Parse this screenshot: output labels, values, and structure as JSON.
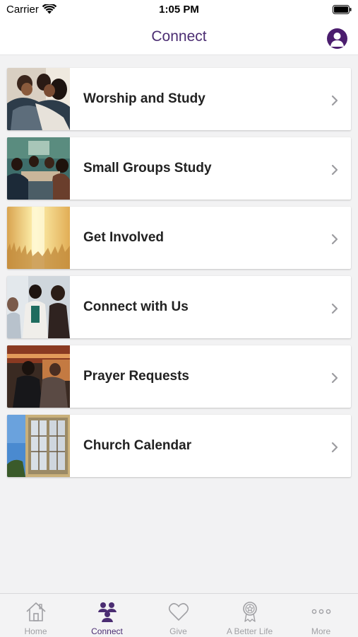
{
  "status": {
    "carrier": "Carrier",
    "time": "1:05 PM"
  },
  "header": {
    "title": "Connect"
  },
  "menu": {
    "items": [
      {
        "label": "Worship and Study",
        "icon": "group-hug-photo"
      },
      {
        "label": "Small Groups Study",
        "icon": "small-group-photo"
      },
      {
        "label": "Get Involved",
        "icon": "raised-hands-photo"
      },
      {
        "label": "Connect with Us",
        "icon": "people-chatting-photo"
      },
      {
        "label": "Prayer Requests",
        "icon": "prayer-photo"
      },
      {
        "label": "Church Calendar",
        "icon": "church-building-photo"
      }
    ]
  },
  "tabs": [
    {
      "label": "Home",
      "icon": "house-icon",
      "active": false
    },
    {
      "label": "Connect",
      "icon": "people-icon",
      "active": true
    },
    {
      "label": "Give",
      "icon": "heart-icon",
      "active": false
    },
    {
      "label": "A Better Life",
      "icon": "award-ribbon-icon",
      "active": false
    },
    {
      "label": "More",
      "icon": "more-dots-icon",
      "active": false
    }
  ],
  "colors": {
    "accent": "#4b2d72",
    "background": "#f2f2f3",
    "inactive_tab": "#a0a0a4"
  }
}
